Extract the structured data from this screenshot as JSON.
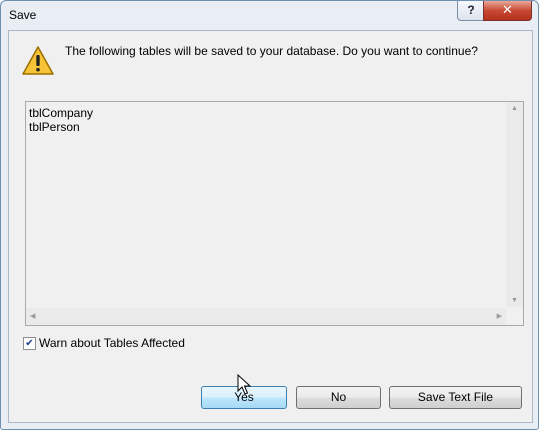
{
  "window": {
    "title": "Save",
    "help_glyph": "?",
    "close_glyph": "✕"
  },
  "dialog": {
    "icon": "warning-icon",
    "message": "The following tables will be saved to your database. Do you want to continue?",
    "tables": [
      "tblCompany",
      "tblPerson"
    ],
    "warn_checkbox": {
      "label": "Warn about Tables Affected",
      "checked": true
    },
    "buttons": {
      "yes": "Yes",
      "no": "No",
      "save_text_file": "Save Text File"
    }
  }
}
